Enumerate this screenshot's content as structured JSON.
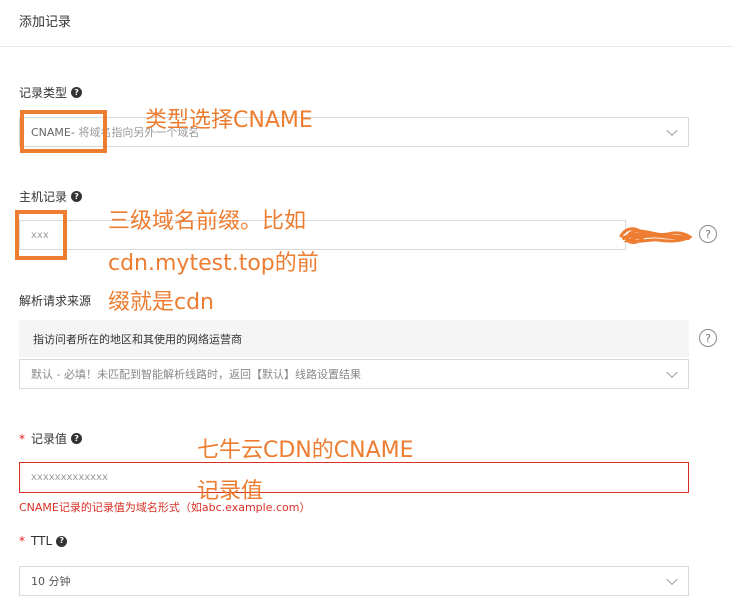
{
  "header": {
    "title": "添加记录"
  },
  "record_type": {
    "label": "记录类型",
    "value": "CNAME-",
    "hint": " 将域名指向另外一个域名"
  },
  "host": {
    "label": "主机记录",
    "placeholder": "xxx"
  },
  "source": {
    "label": "解析请求来源",
    "info": "指访问者所在的地区和其使用的网络运营商",
    "select_value": "默认 - 必填！未匹配到智能解析线路时，返回【默认】线路设置结果"
  },
  "record_value": {
    "label": "记录值",
    "placeholder": "xxxxxxxxxxxxx",
    "error": "CNAME记录的记录值为域名形式（如abc.example.com）"
  },
  "ttl": {
    "label": "TTL",
    "value": "10 分钟"
  },
  "icons": {
    "help": "?"
  },
  "annotations": {
    "type_note": "类型选择CNAME",
    "host_note_1": "三级域名前缀。比如",
    "host_note_2": "cdn.mytest.top的前",
    "host_note_3": "缀就是cdn",
    "value_note_1": "七牛云CDN的CNAME",
    "value_note_2": "记录值"
  },
  "colors": {
    "annotation": "#ed7d31",
    "error": "#d93026"
  }
}
